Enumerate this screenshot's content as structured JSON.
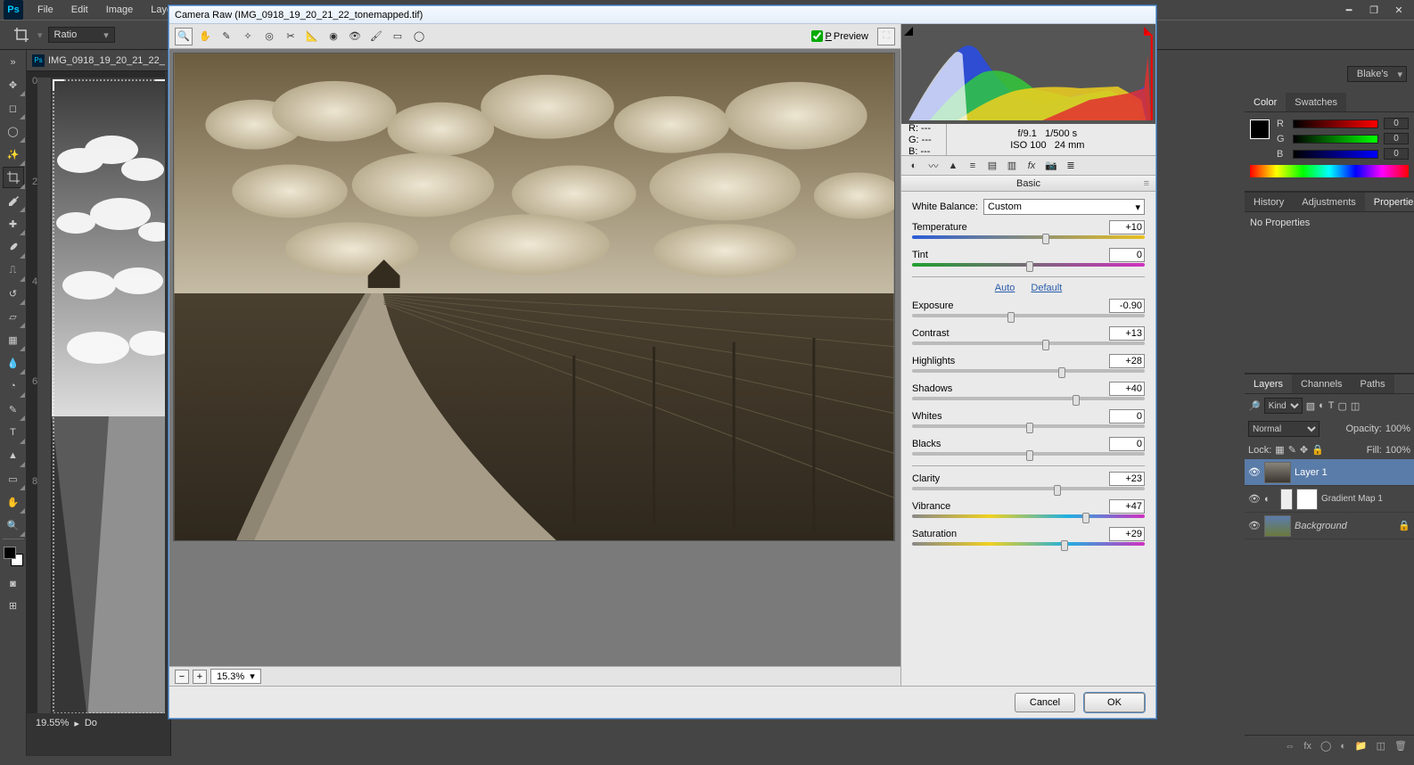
{
  "menu": {
    "file": "File",
    "edit": "Edit",
    "image": "Image",
    "layer": "Laye"
  },
  "workspace": "Blake's",
  "options_bar": {
    "ratio": "Ratio"
  },
  "doc_tab": "IMG_0918_19_20_21_22_",
  "status": {
    "zoom": "19.55%",
    "doc_prefix": "Do"
  },
  "craw": {
    "title": "Camera Raw (IMG_0918_19_20_21_22_tonemapped.tif)",
    "preview": "Preview",
    "zoom": "15.3%",
    "meta_r": "R:    ---",
    "meta_g": "G:    ---",
    "meta_b": "B:    ---",
    "aperture": "f/9.1",
    "shutter": "1/500 s",
    "iso": "ISO 100",
    "fl": "24 mm",
    "basic_head": "Basic",
    "wb_label": "White Balance:",
    "wb_value": "Custom",
    "temp": {
      "label": "Temperature",
      "value": "+10"
    },
    "tint": {
      "label": "Tint",
      "value": "0"
    },
    "auto": "Auto",
    "default": "Default",
    "exposure": {
      "label": "Exposure",
      "value": "-0.90"
    },
    "contrast": {
      "label": "Contrast",
      "value": "+13"
    },
    "highlights": {
      "label": "Highlights",
      "value": "+28"
    },
    "shadows": {
      "label": "Shadows",
      "value": "+40"
    },
    "whites": {
      "label": "Whites",
      "value": "0"
    },
    "blacks": {
      "label": "Blacks",
      "value": "0"
    },
    "clarity": {
      "label": "Clarity",
      "value": "+23"
    },
    "vibrance": {
      "label": "Vibrance",
      "value": "+47"
    },
    "saturation": {
      "label": "Saturation",
      "value": "+29"
    },
    "cancel": "Cancel",
    "ok": "OK"
  },
  "color_panel": {
    "tab_color": "Color",
    "tab_swatches": "Swatches",
    "r": "R",
    "g": "G",
    "b": "B",
    "rv": "0",
    "gv": "0",
    "bv": "0"
  },
  "hist_panel": {
    "history": "History",
    "adjustments": "Adjustments",
    "properties": "Properties",
    "no_props": "No Properties"
  },
  "layers_panel": {
    "tabs": {
      "layers": "Layers",
      "channels": "Channels",
      "paths": "Paths"
    },
    "kind": "Kind",
    "blend": "Normal",
    "opacity_label": "Opacity:",
    "opacity": "100%",
    "lock_label": "Lock:",
    "fill_label": "Fill:",
    "fill": "100%",
    "layer1": "Layer 1",
    "gmap": "Gradient Map 1",
    "bg": "Background"
  }
}
